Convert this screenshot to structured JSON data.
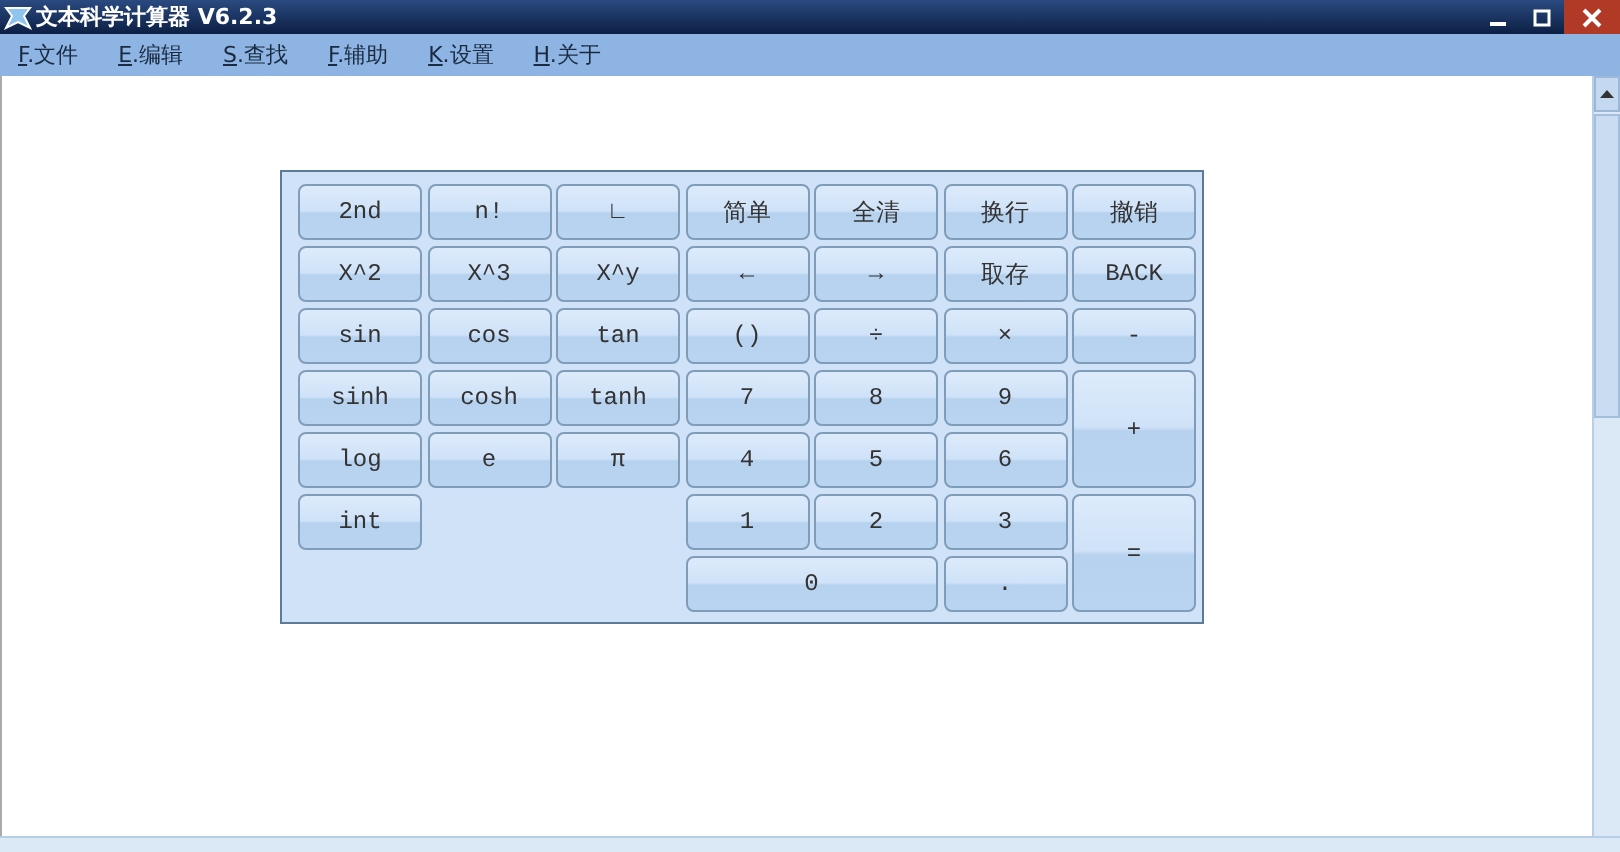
{
  "window": {
    "title": "文本科学计算器 V6.2.3"
  },
  "menu": [
    {
      "key": "F",
      "label": ".文件"
    },
    {
      "key": "E",
      "label": ".编辑"
    },
    {
      "key": "S",
      "label": ".查找"
    },
    {
      "key": "F",
      "label": ".辅助"
    },
    {
      "key": "K",
      "label": ".设置"
    },
    {
      "key": "H",
      "label": ".关于"
    }
  ],
  "keypad": {
    "keys": [
      "2nd",
      "n!",
      "∟",
      "简单",
      "全清",
      "换行",
      "撤销",
      "X^2",
      "X^3",
      "X^y",
      "←",
      "→",
      "取存",
      "BACK",
      "sin",
      "cos",
      "tan",
      "()",
      "÷",
      "×",
      "-",
      "sinh",
      "cosh",
      "tanh",
      "7",
      "8",
      "9",
      "+",
      "log",
      "e",
      "π",
      "4",
      "5",
      "6",
      "int",
      "1",
      "2",
      "3",
      "=",
      "0",
      "."
    ]
  }
}
